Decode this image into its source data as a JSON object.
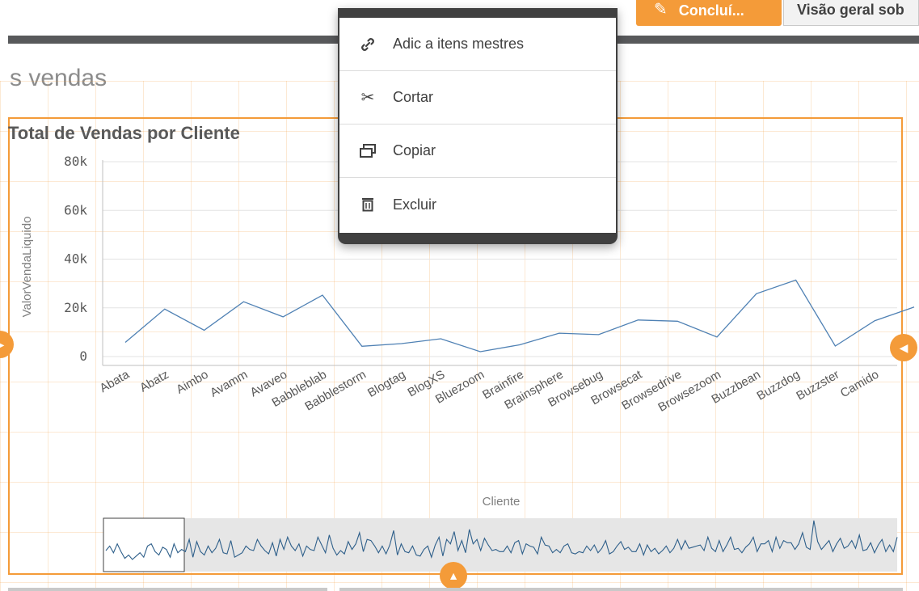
{
  "header": {
    "edit_label": "Concluí...",
    "sheet_tab_label": "Visão geral sob"
  },
  "sheet": {
    "title": "s vendas"
  },
  "context_menu": {
    "items": [
      {
        "label": "Adic a itens mestres",
        "icon": "link-icon"
      },
      {
        "label": "Cortar",
        "icon": "scissors-icon"
      },
      {
        "label": "Copiar",
        "icon": "copy-icon"
      },
      {
        "label": "Excluir",
        "icon": "trash-icon"
      }
    ]
  },
  "chart_data": {
    "type": "line",
    "title": "Total de Vendas por Cliente",
    "xlabel": "Cliente",
    "ylabel": "ValorVendaLiquido",
    "ylim": [
      0,
      80000
    ],
    "yticks": [
      {
        "value": 0,
        "label": "0"
      },
      {
        "value": 20000,
        "label": "20k"
      },
      {
        "value": 40000,
        "label": "40k"
      },
      {
        "value": 60000,
        "label": "60k"
      },
      {
        "value": 80000,
        "label": "80k"
      }
    ],
    "categories": [
      "Abata",
      "Abatz",
      "Aimbo",
      "Avamm",
      "Avaveo",
      "Babbleblab",
      "Babblestorm",
      "Blogtag",
      "BlogXS",
      "Bluezoom",
      "Brainfire",
      "Brainsphere",
      "Browsebug",
      "Browsecat",
      "Browsedrive",
      "Browsezoom",
      "Buzzbean",
      "Buzzdog",
      "Buzzster",
      "Camido"
    ],
    "values": [
      5800,
      19500,
      10800,
      22500,
      16300,
      25200,
      4200,
      5300,
      7300,
      2000,
      4800,
      9600,
      9000,
      15000,
      14500,
      8000,
      25800,
      31400,
      4300,
      14700,
      20300
    ],
    "grid": true,
    "legend": "none",
    "scrollbar": {
      "values": [
        16,
        20,
        14,
        22,
        15,
        9,
        12,
        8,
        11,
        14,
        10,
        20,
        22,
        15,
        12,
        19,
        17,
        10,
        22,
        14,
        17,
        15,
        26,
        10,
        24,
        15,
        12,
        20,
        14,
        18,
        26,
        14,
        13,
        25,
        10,
        12,
        14,
        20,
        17,
        16,
        26,
        20,
        16,
        13,
        23,
        11,
        26,
        17,
        28,
        20,
        16,
        22,
        11,
        20,
        17,
        16,
        28,
        21,
        14,
        30,
        18,
        12,
        16,
        13,
        24,
        17,
        22,
        32,
        15,
        26,
        25,
        20,
        14,
        20,
        13,
        21,
        34,
        12,
        22,
        15,
        14,
        20,
        12,
        11,
        17,
        20,
        10,
        21,
        28,
        11,
        26,
        22,
        33,
        16,
        25,
        14,
        35,
        22,
        26,
        16,
        27,
        21,
        16,
        17,
        15,
        15,
        20,
        14,
        23,
        25,
        13,
        22,
        20,
        19,
        13,
        28,
        21,
        20,
        14,
        17,
        14,
        20,
        22,
        14,
        13,
        15,
        14,
        20,
        16,
        21,
        14,
        18,
        25,
        13,
        15,
        20,
        24,
        17,
        19,
        15,
        15,
        22,
        12,
        21,
        15,
        18,
        13,
        16,
        20,
        14,
        18,
        26,
        17,
        25,
        18,
        19,
        20,
        21,
        16,
        28,
        18,
        15,
        25,
        15,
        21,
        28,
        17,
        18,
        14,
        19,
        22,
        28,
        15,
        22,
        22,
        25,
        15,
        28,
        18,
        25,
        23,
        23,
        17,
        22,
        32,
        19,
        17,
        43,
        24,
        17,
        21,
        25,
        15,
        22,
        27,
        18,
        20,
        25,
        18,
        30,
        16,
        17,
        23,
        14,
        21,
        26,
        15,
        21,
        15,
        28
      ]
    }
  }
}
